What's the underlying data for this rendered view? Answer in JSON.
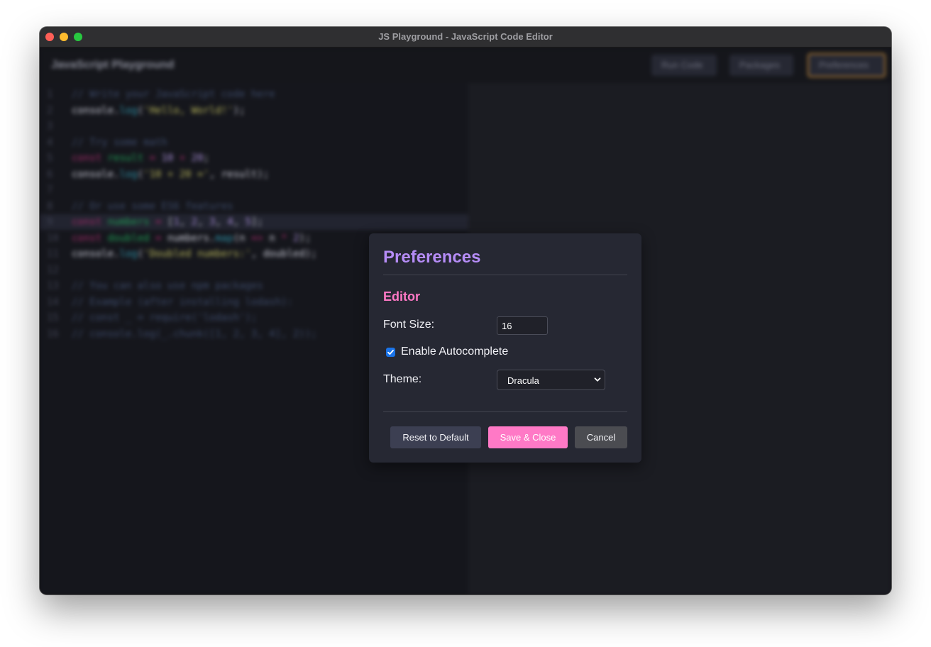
{
  "window": {
    "title": "JS Playground - JavaScript Code Editor"
  },
  "app": {
    "title": "JavaScript Playground",
    "header_buttons": {
      "run": "Run Code",
      "packages": "Packages",
      "preferences": "Preferences"
    }
  },
  "editor": {
    "lines": [
      {
        "n": "1",
        "text": "// Write your JavaScript code here"
      },
      {
        "n": "2",
        "text": "console.log('Hello, World!');"
      },
      {
        "n": "3",
        "text": ""
      },
      {
        "n": "4",
        "text": "// Try some math"
      },
      {
        "n": "5",
        "text": "const result = 10 + 20;"
      },
      {
        "n": "6",
        "text": "console.log('10 + 20 =', result);"
      },
      {
        "n": "7",
        "text": ""
      },
      {
        "n": "8",
        "text": "// Or use some ES6 features"
      },
      {
        "n": "9",
        "text": "const numbers = [1, 2, 3, 4, 5];"
      },
      {
        "n": "10",
        "text": "const doubled = numbers.map(n => n * 2);"
      },
      {
        "n": "11",
        "text": "console.log('Doubled numbers:', doubled);"
      },
      {
        "n": "12",
        "text": ""
      },
      {
        "n": "13",
        "text": "// You can also use npm packages"
      },
      {
        "n": "14",
        "text": "// Example (after installing lodash):"
      },
      {
        "n": "15",
        "text": "// const _ = require('lodash');"
      },
      {
        "n": "16",
        "text": "// console.log(_.chunk([1, 2, 3, 4], 2));"
      }
    ]
  },
  "modal": {
    "title": "Preferences",
    "section": "Editor",
    "font_size_label": "Font Size:",
    "font_size_value": "16",
    "autocomplete_label": "Enable Autocomplete",
    "autocomplete_checked": true,
    "theme_label": "Theme:",
    "theme_value": "Dracula",
    "buttons": {
      "reset": "Reset to Default",
      "save": "Save & Close",
      "cancel": "Cancel"
    }
  },
  "colors": {
    "accent_purple": "#b58cf6",
    "accent_pink": "#ff79c6",
    "modal_bg": "#262833"
  }
}
